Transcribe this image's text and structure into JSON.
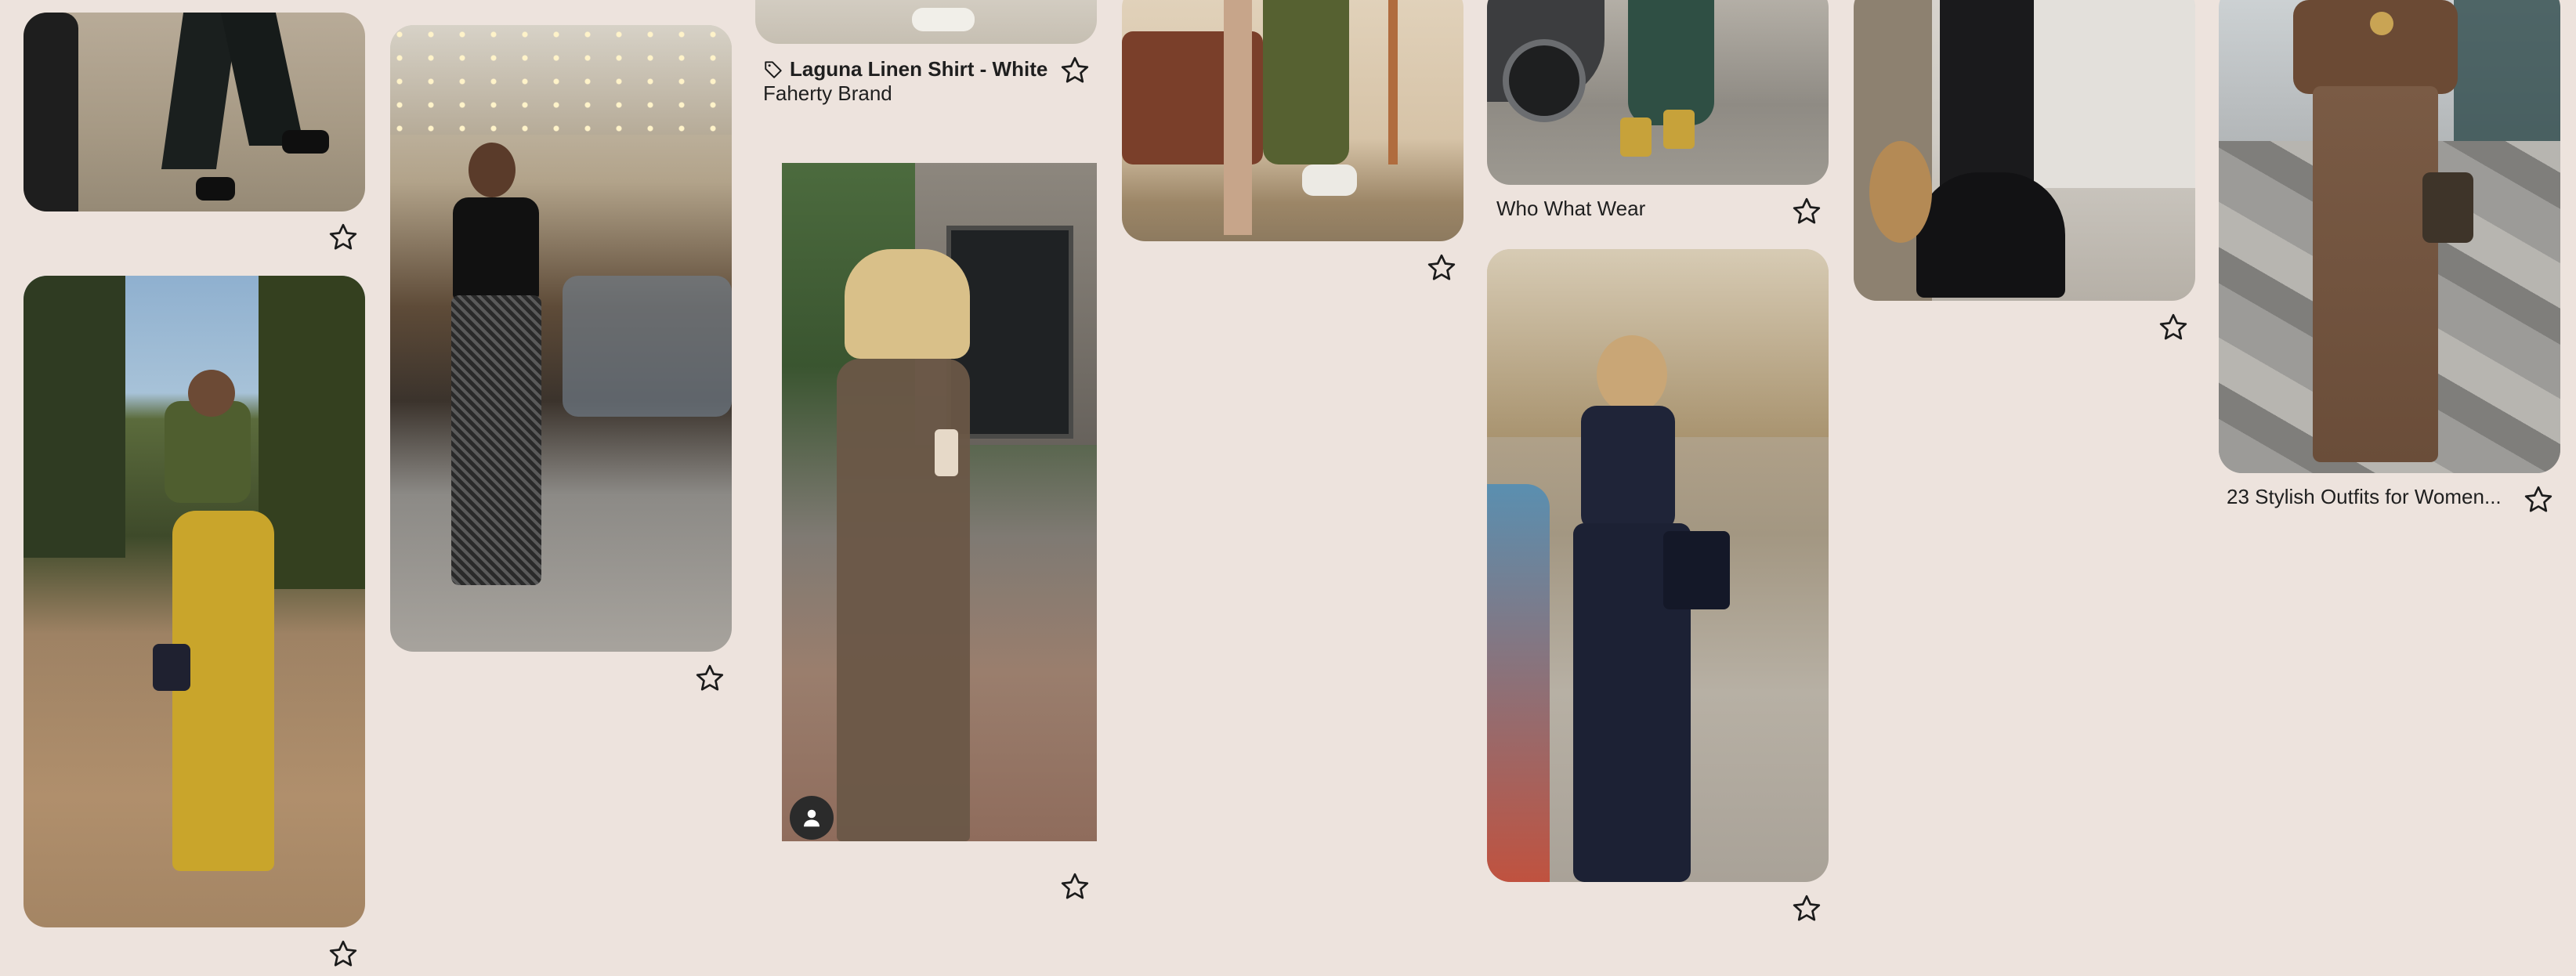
{
  "colors": {
    "background": "#ede3dd",
    "star_stroke": "#1b1b1b"
  },
  "icons": {
    "save": "star-icon",
    "tag": "tag-icon",
    "user": "user-icon"
  },
  "pins": [
    {
      "id": "c1-top",
      "caption": "",
      "save": "star-icon"
    },
    {
      "id": "c1-green-top-yellow-trousers",
      "caption": "",
      "save": "star-icon"
    },
    {
      "id": "c2-black-top-patterned-trousers",
      "caption": "",
      "save": "star-icon"
    },
    {
      "id": "c3-top",
      "caption_bold": "Laguna Linen Shirt - White",
      "caption_sub": "Faherty Brand",
      "save": "star-icon"
    },
    {
      "id": "c3-brown-sheer-dress",
      "caption": "",
      "save": "star-icon"
    },
    {
      "id": "c4-green-trousers",
      "caption": "",
      "save": "star-icon"
    },
    {
      "id": "c5-top",
      "caption": "Who What Wear",
      "save": "star-icon"
    },
    {
      "id": "c5-navy-jumpsuit",
      "caption": "",
      "save": "star-icon"
    },
    {
      "id": "c6-black-dress",
      "caption": "",
      "save": "star-icon"
    },
    {
      "id": "c7-brown-trousers",
      "caption": "23 Stylish Outfits for Women...",
      "save": "star-icon"
    }
  ]
}
